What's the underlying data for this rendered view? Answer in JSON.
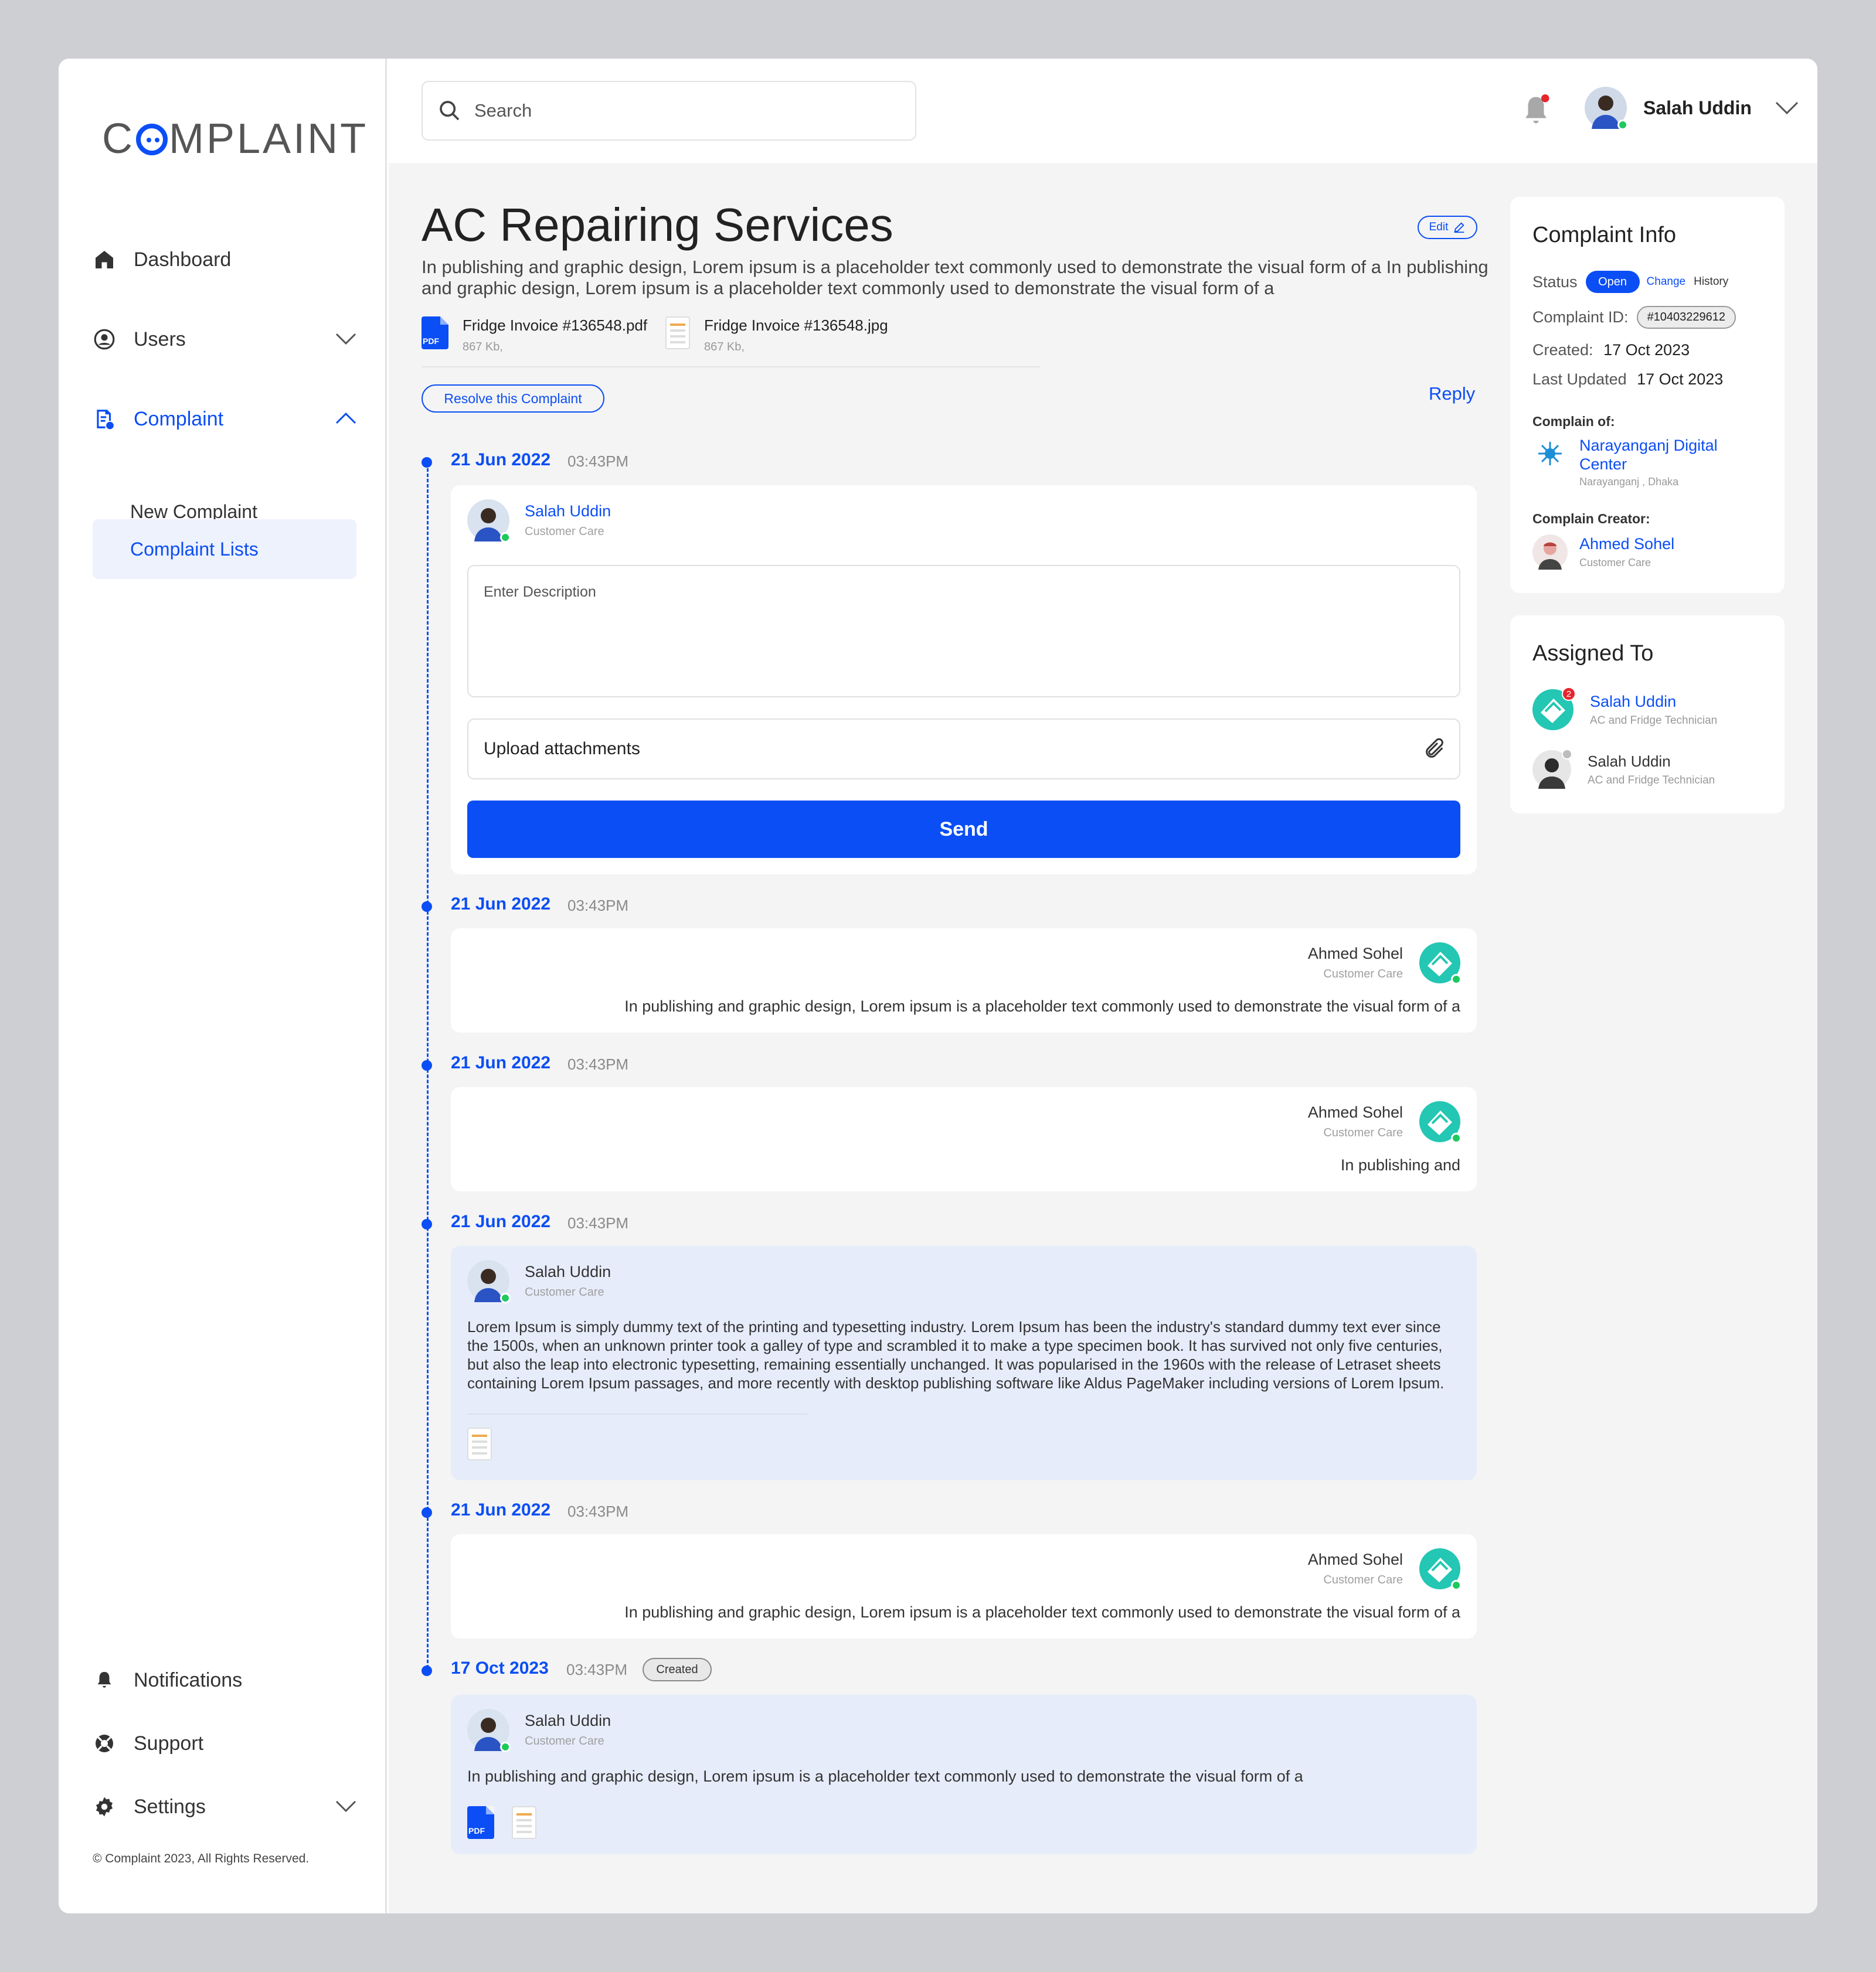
{
  "brand": {
    "logo_pre": "C",
    "logo_post": "MPLAINT"
  },
  "sidebar": {
    "dashboard": "Dashboard",
    "users": "Users",
    "complaint": "Complaint",
    "new_complaint": "New Complaint",
    "complaint_lists": "Complaint Lists",
    "notifications": "Notifications",
    "support": "Support",
    "settings": "Settings",
    "copyright": "© Complaint 2023, All Rights Reserved."
  },
  "topbar": {
    "search_placeholder": "Search",
    "user_name": "Salah Uddin"
  },
  "complaint": {
    "title": "AC Repairing Services",
    "edit_label": "Edit",
    "description": "In publishing and graphic design, Lorem ipsum is a placeholder text commonly used to demonstrate the visual form of a In publishing and graphic design, Lorem ipsum is a placeholder text commonly used to demonstrate the visual form of a",
    "attachments": [
      {
        "name": "Fridge Invoice #136548.pdf",
        "size": "867 Kb,"
      },
      {
        "name": "Fridge Invoice #136548.jpg",
        "size": "867 Kb,"
      }
    ],
    "resolve_label": "Resolve this Complaint",
    "reply_label": "Reply"
  },
  "timeline": {
    "e1": {
      "date": "21 Jun 2022",
      "time": "03:43PM",
      "user": "Salah Uddin",
      "role": "Customer Care",
      "desc_placeholder": "Enter Description",
      "upload_label": "Upload attachments",
      "send_label": "Send"
    },
    "e2": {
      "date": "21 Jun 2022",
      "time": "03:43PM",
      "user": "Ahmed Sohel",
      "role": "Customer Care",
      "text": "In publishing and graphic design, Lorem ipsum is a placeholder text commonly used to demonstrate the visual form of a"
    },
    "e3": {
      "date": "21 Jun 2022",
      "time": "03:43PM",
      "user": "Ahmed Sohel",
      "role": "Customer Care",
      "text": "In publishing and"
    },
    "e4": {
      "date": "21 Jun 2022",
      "time": "03:43PM",
      "user": "Salah Uddin",
      "role": "Customer Care",
      "text": "Lorem Ipsum is simply dummy text of the printing and typesetting industry. Lorem Ipsum has been the industry's standard dummy text ever since the 1500s, when an unknown printer took a galley of type and scrambled it to make a type specimen book. It has survived not only five centuries, but also the leap into electronic typesetting, remaining essentially unchanged. It was popularised in the 1960s with the release of Letraset sheets containing Lorem Ipsum passages, and more recently with desktop publishing software like Aldus PageMaker including versions of Lorem Ipsum."
    },
    "e5": {
      "date": "21 Jun 2022",
      "time": "03:43PM",
      "user": "Ahmed Sohel",
      "role": "Customer Care",
      "text": "In publishing and graphic design, Lorem ipsum is a placeholder text commonly used to demonstrate the visual form of a"
    },
    "e6": {
      "date": "17 Oct 2023",
      "time": "03:43PM",
      "badge": "Created",
      "user": "Salah Uddin",
      "role": "Customer Care",
      "text": "In publishing and graphic design, Lorem ipsum is a placeholder text commonly used to demonstrate the visual form of a"
    }
  },
  "info": {
    "title": "Complaint Info",
    "status_label": "Status",
    "status_value": "Open",
    "change_label": "Change",
    "history_label": "History",
    "id_label": "Complaint ID:",
    "id_value": "#10403229612",
    "created_label": "Created:",
    "created_value": "17 Oct 2023",
    "updated_label": "Last Updated",
    "updated_value": "17 Oct 2023",
    "complain_of_label": "Complain of:",
    "org_name": "Narayanganj Digital Center",
    "org_location": "Narayanganj , Dhaka",
    "creator_label": "Complain Creator:",
    "creator_name": "Ahmed Sohel",
    "creator_role": "Customer Care"
  },
  "assigned": {
    "title": "Assigned To",
    "a1": {
      "name": "Salah Uddin",
      "role": "AC and Fridge Technician",
      "badge": "2"
    },
    "a2": {
      "name": "Salah Uddin",
      "role": "AC and Fridge Technician"
    }
  },
  "colors": {
    "accent": "#0b4ef5",
    "online": "#1ec95c",
    "light_blue_card": "#e7ecfb"
  }
}
